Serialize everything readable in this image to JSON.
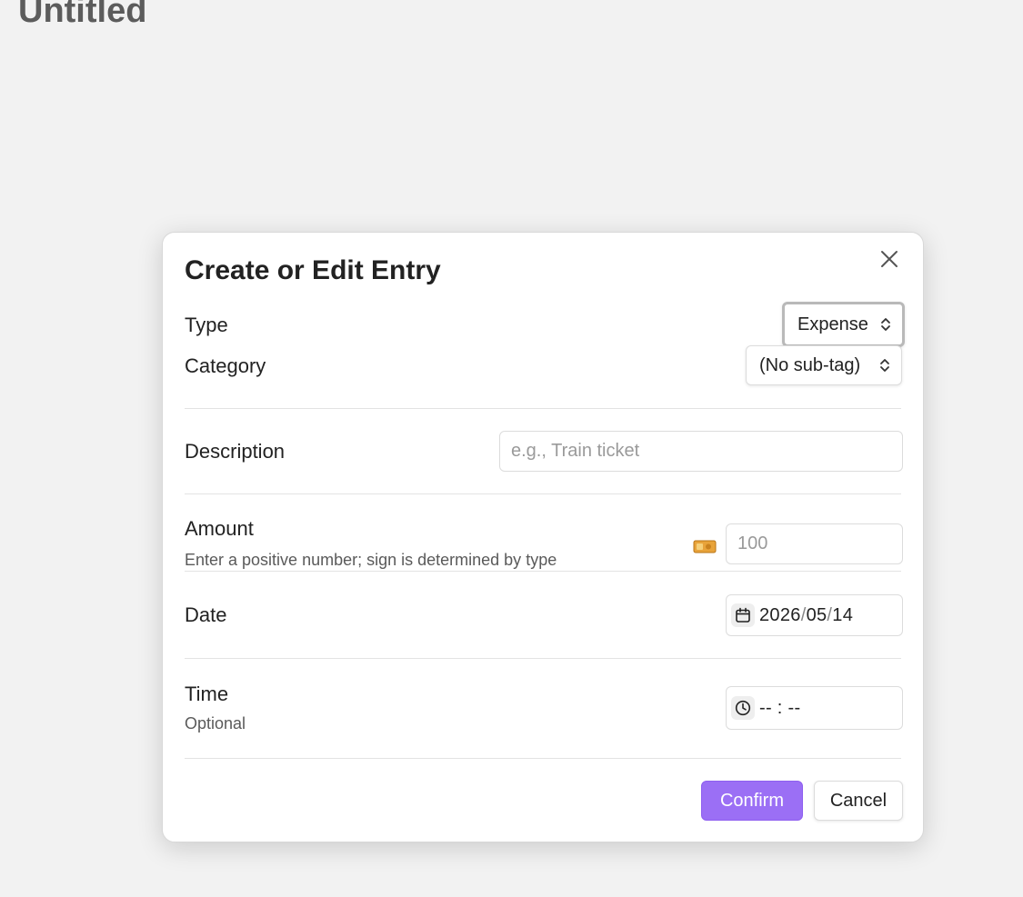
{
  "page": {
    "title": "Untitled"
  },
  "modal": {
    "title": "Create or Edit Entry",
    "close_icon": "close-icon",
    "type": {
      "label": "Type",
      "value": "Expense"
    },
    "category": {
      "label": "Category",
      "value": "(No sub-tag)"
    },
    "description": {
      "label": "Description",
      "placeholder": "e.g., Train ticket"
    },
    "amount": {
      "label": "Amount",
      "hint": "Enter a positive number; sign is determined by type",
      "icon": "money-icon",
      "placeholder": "100"
    },
    "date": {
      "label": "Date",
      "icon": "calendar-icon",
      "year": "2026",
      "month": "05",
      "day": "14",
      "separator": "/"
    },
    "time": {
      "label": "Time",
      "hint": "Optional",
      "icon": "clock-icon",
      "value": "-- : --"
    },
    "buttons": {
      "confirm": "Confirm",
      "cancel": "Cancel"
    },
    "colors": {
      "accent": "#9b6ff5",
      "background": "#f2f2f2"
    }
  }
}
